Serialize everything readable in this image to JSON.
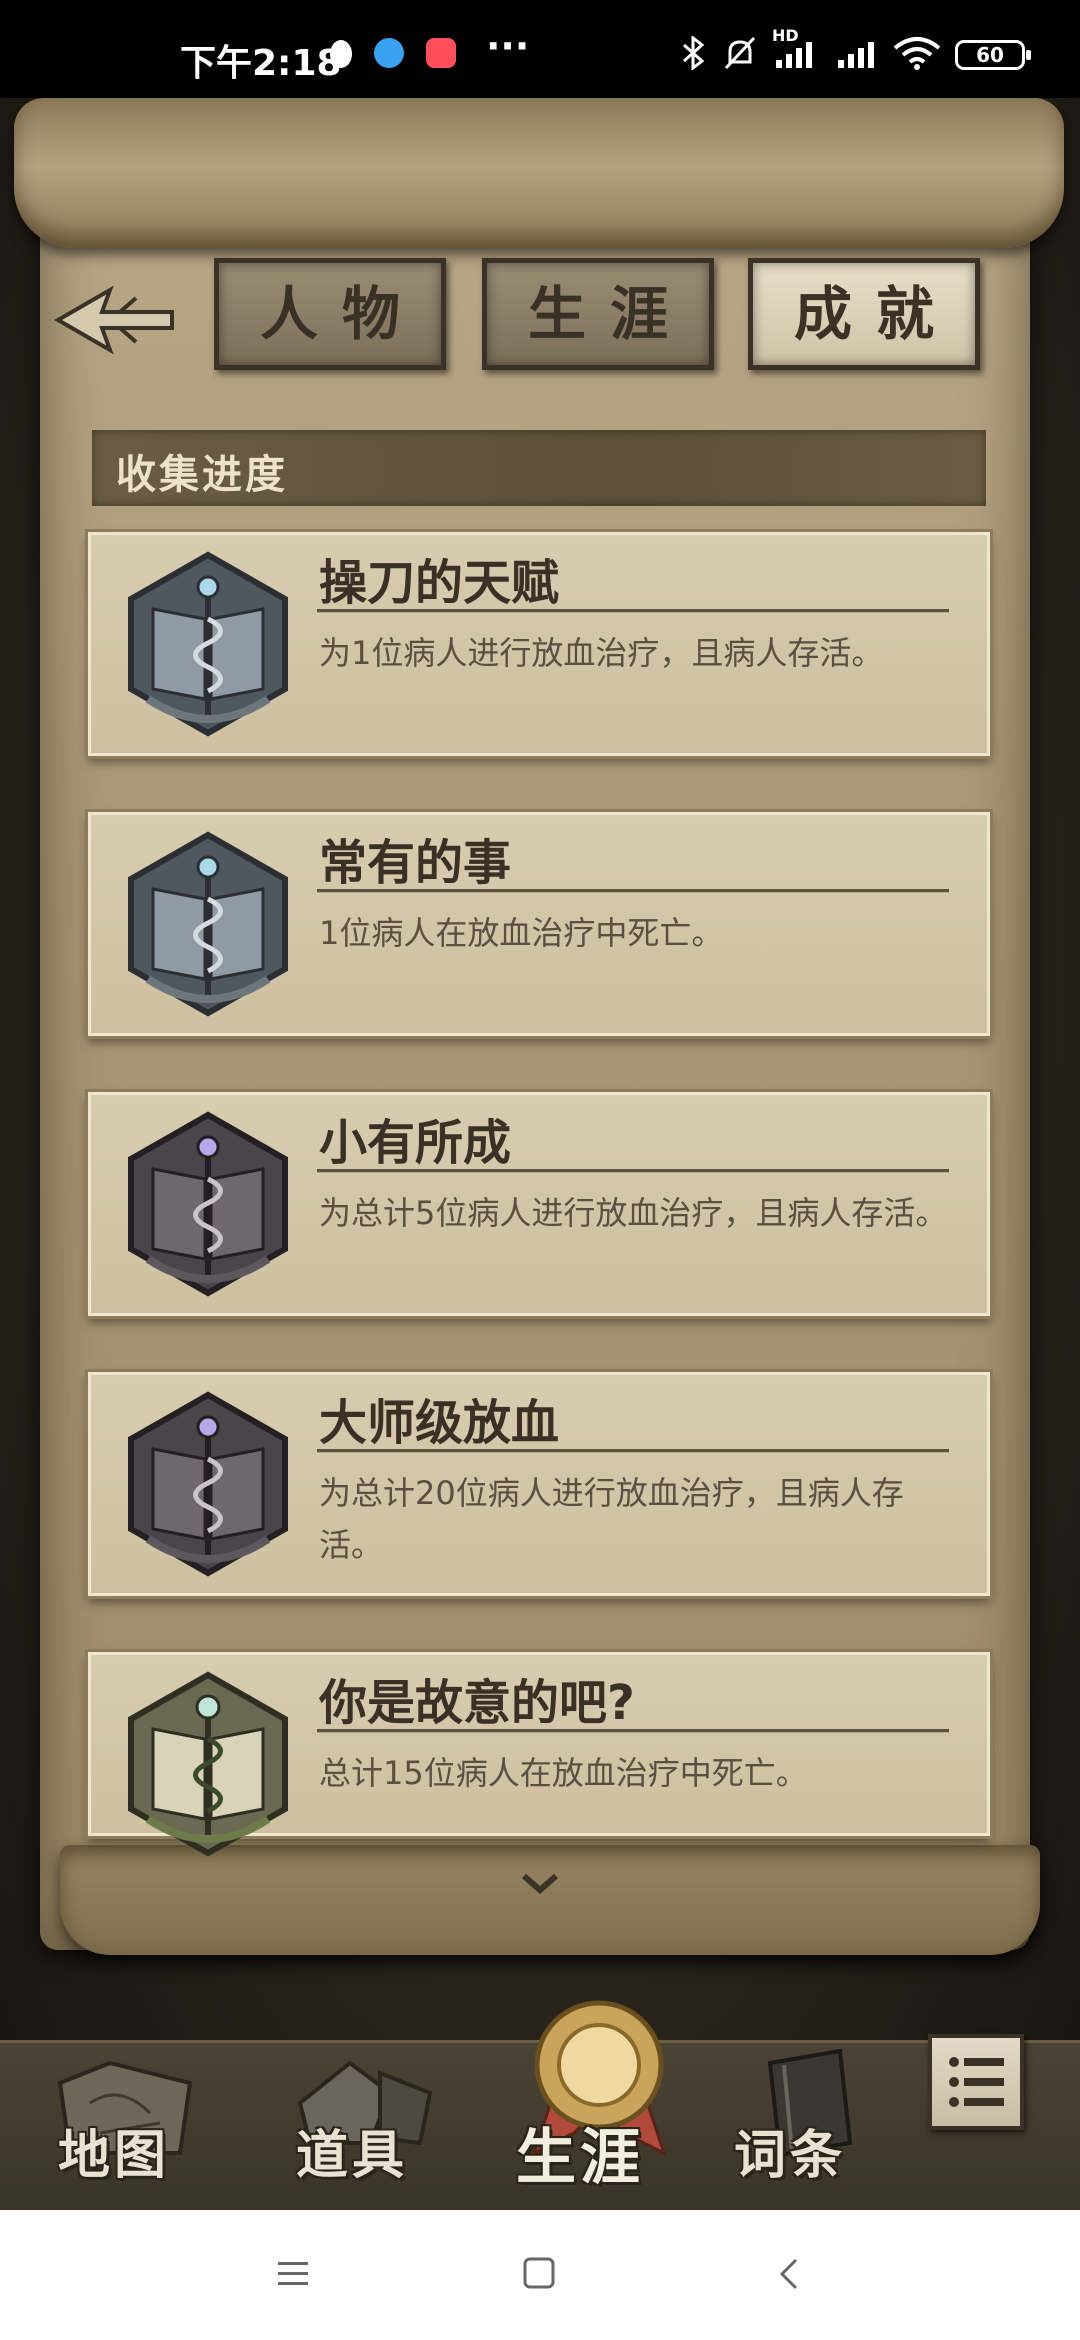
{
  "status_bar": {
    "time": "下午2:18",
    "battery": "60",
    "network": "HD"
  },
  "header": {
    "tabs": [
      {
        "label": "人物",
        "active": false
      },
      {
        "label": "生涯",
        "active": false
      },
      {
        "label": "成就",
        "active": true
      }
    ]
  },
  "section": {
    "title": "收集进度"
  },
  "achievements": [
    {
      "title": "操刀的天赋",
      "desc": "为1位病人进行放血治疗，且病人存活。",
      "badge": "silver-caduceus-book-badge"
    },
    {
      "title": "常有的事",
      "desc": "1位病人在放血治疗中死亡。",
      "badge": "silver-caduceus-book-badge"
    },
    {
      "title": "小有所成",
      "desc": "为总计5位病人进行放血治疗，且病人存活。",
      "badge": "dark-caduceus-book-badge"
    },
    {
      "title": "大师级放血",
      "desc": "为总计20位病人进行放血治疗，且病人存活。",
      "badge": "dark-caduceus-book-badge"
    },
    {
      "title": "你是故意的吧?",
      "desc": "总计15位病人在放血治疗中死亡。",
      "badge": "bronze-caduceus-book-badge"
    }
  ],
  "bottom_nav": {
    "items": [
      {
        "label": "地图",
        "icon": "map-icon"
      },
      {
        "label": "道具",
        "icon": "items-icon"
      },
      {
        "label": "生涯",
        "icon": "medal-icon",
        "active": true
      },
      {
        "label": "词条",
        "icon": "book-icon"
      }
    ],
    "menu_icon": "list-icon"
  },
  "colors": {
    "parchment": "#cdbf9f",
    "ink": "#3a3026",
    "header_bar": "#5d4f38"
  }
}
